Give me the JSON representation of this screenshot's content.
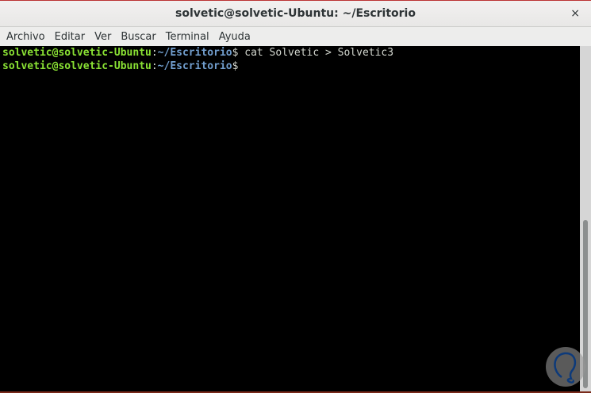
{
  "window": {
    "title": "solvetic@solvetic-Ubuntu: ~/Escritorio",
    "close_label": "×"
  },
  "menu": [
    "Archivo",
    "Editar",
    "Ver",
    "Buscar",
    "Terminal",
    "Ayuda"
  ],
  "terminal": {
    "lines": [
      {
        "user": "solvetic@solvetic-Ubuntu",
        "sep": ":",
        "path": "~/Escritorio",
        "prompt": "$",
        "command": " cat Solvetic > Solvetic3"
      },
      {
        "user": "solvetic@solvetic-Ubuntu",
        "sep": ":",
        "path": "~/Escritorio",
        "prompt": "$",
        "command": ""
      }
    ]
  },
  "scrollbar": {
    "position_fraction": 1.0
  },
  "watermark": {
    "text": "Solvetic"
  }
}
